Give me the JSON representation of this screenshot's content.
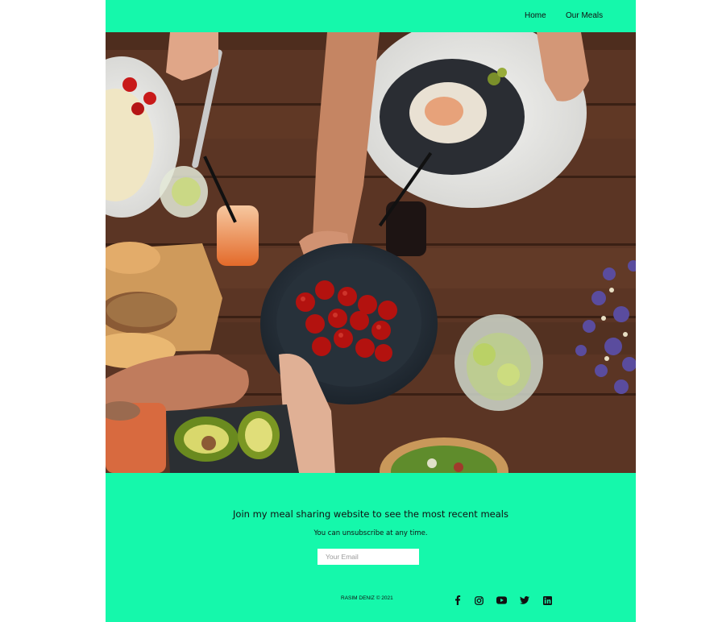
{
  "nav": {
    "home_label": "Home",
    "meals_label": "Our Meals"
  },
  "hero": {
    "image": "people-sharing-food-at-wooden-table"
  },
  "newsletter": {
    "headline": "Join my meal sharing website to see the most recent meals",
    "subtext": "You can unsubscribe at any time.",
    "email_placeholder": "Your Email",
    "email_value": ""
  },
  "footer": {
    "copyright": "RASIM DENIZ © 2021",
    "social": [
      "facebook-icon",
      "instagram-icon",
      "youtube-icon",
      "twitter-icon",
      "linkedin-icon"
    ]
  },
  "colors": {
    "accent": "#15f8ab",
    "text": "#111111",
    "wood": "#5a3422"
  }
}
